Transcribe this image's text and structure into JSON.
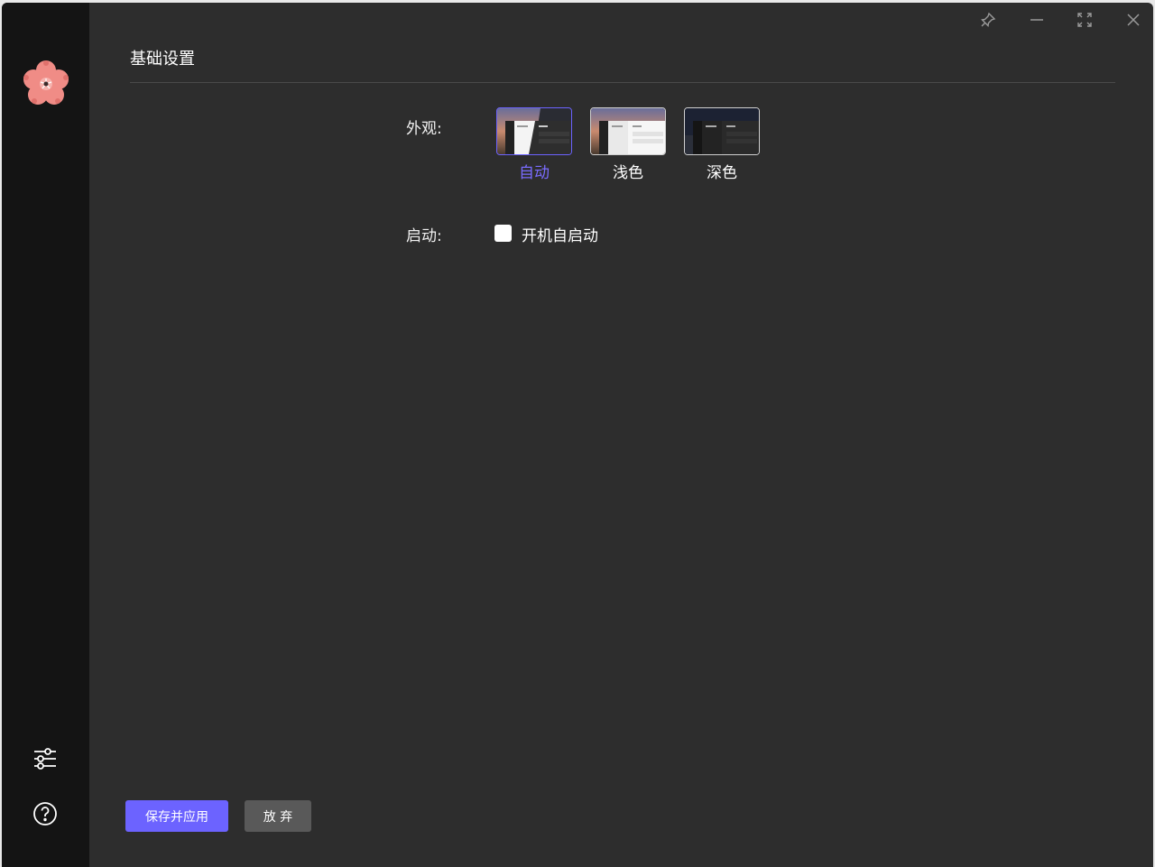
{
  "window": {
    "controls": {
      "pin_icon": "pin-icon",
      "minimize_icon": "minimize-icon",
      "maximize_icon": "maximize-icon",
      "close_icon": "close-icon"
    }
  },
  "sidebar": {
    "logo_icon": "sakura-flower-icon",
    "settings_icon": "sliders-icon",
    "help_icon": "help-circle-icon"
  },
  "page": {
    "title": "基础设置"
  },
  "appearance": {
    "label": "外观:",
    "selected": "自动",
    "options": [
      {
        "label": "自动",
        "selected": true
      },
      {
        "label": "浅色",
        "selected": false
      },
      {
        "label": "深色",
        "selected": false
      }
    ]
  },
  "startup": {
    "label": "启动:",
    "checkbox_label": "开机自启动",
    "checked": false
  },
  "actions": {
    "save_label": "保存并应用",
    "discard_label": "放 弃"
  },
  "colors": {
    "accent": "#6c63ff",
    "background": "#2d2d2d",
    "sidebar": "#141414",
    "secondary_button": "#595959"
  }
}
